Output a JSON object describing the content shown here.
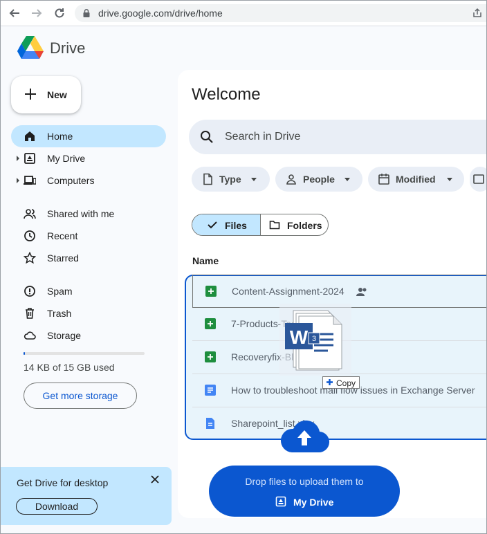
{
  "browser": {
    "url": "drive.google.com/drive/home"
  },
  "app": {
    "name": "Drive",
    "new_label": "New"
  },
  "sidebar": {
    "items": [
      {
        "label": "Home",
        "icon": "home-icon",
        "active": true
      },
      {
        "label": "My Drive",
        "icon": "my-drive-icon"
      },
      {
        "label": "Computers",
        "icon": "computer-icon"
      },
      {
        "label": "Shared with me",
        "icon": "people-icon"
      },
      {
        "label": "Recent",
        "icon": "clock-icon"
      },
      {
        "label": "Starred",
        "icon": "star-icon"
      },
      {
        "label": "Spam",
        "icon": "spam-icon"
      },
      {
        "label": "Trash",
        "icon": "trash-icon"
      },
      {
        "label": "Storage",
        "icon": "cloud-icon"
      }
    ],
    "storage_used_fraction": 9e-07,
    "storage_text": "14 KB of 15 GB used",
    "get_storage_label": "Get more storage"
  },
  "promo": {
    "title": "Get Drive for desktop",
    "download_label": "Download"
  },
  "main": {
    "title": "Welcome",
    "search_placeholder": "Search in Drive",
    "filters": [
      {
        "label": "Type",
        "icon": "file-icon"
      },
      {
        "label": "People",
        "icon": "person-icon"
      },
      {
        "label": "Modified",
        "icon": "calendar-icon"
      }
    ],
    "toggle": {
      "files": "Files",
      "folders": "Folders",
      "selected": "files"
    },
    "column_name": "Name",
    "files": [
      {
        "name": "Content-Assignment-2024",
        "type": "sheet",
        "shared": true
      },
      {
        "name": "7-Products-Tasks",
        "type": "sheet",
        "shared": true
      },
      {
        "name": "Recoveryfix-Blogs",
        "type": "sheet",
        "shared": true
      },
      {
        "name": "How to troubleshoot mail flow issues in Exchange Server",
        "type": "doc",
        "shared": false
      },
      {
        "name": "Sharepoint_list.xlsx",
        "type": "file",
        "shared": false
      }
    ]
  },
  "drag": {
    "count": "3",
    "app_letter": "W",
    "copy_label": "Copy"
  },
  "upload": {
    "line1": "Drop files to upload them to",
    "destination": "My Drive"
  },
  "colors": {
    "accent": "#0b57d0",
    "selected": "#c2e7ff",
    "sheet": "#1e8e3e",
    "doc": "#4285f4"
  }
}
